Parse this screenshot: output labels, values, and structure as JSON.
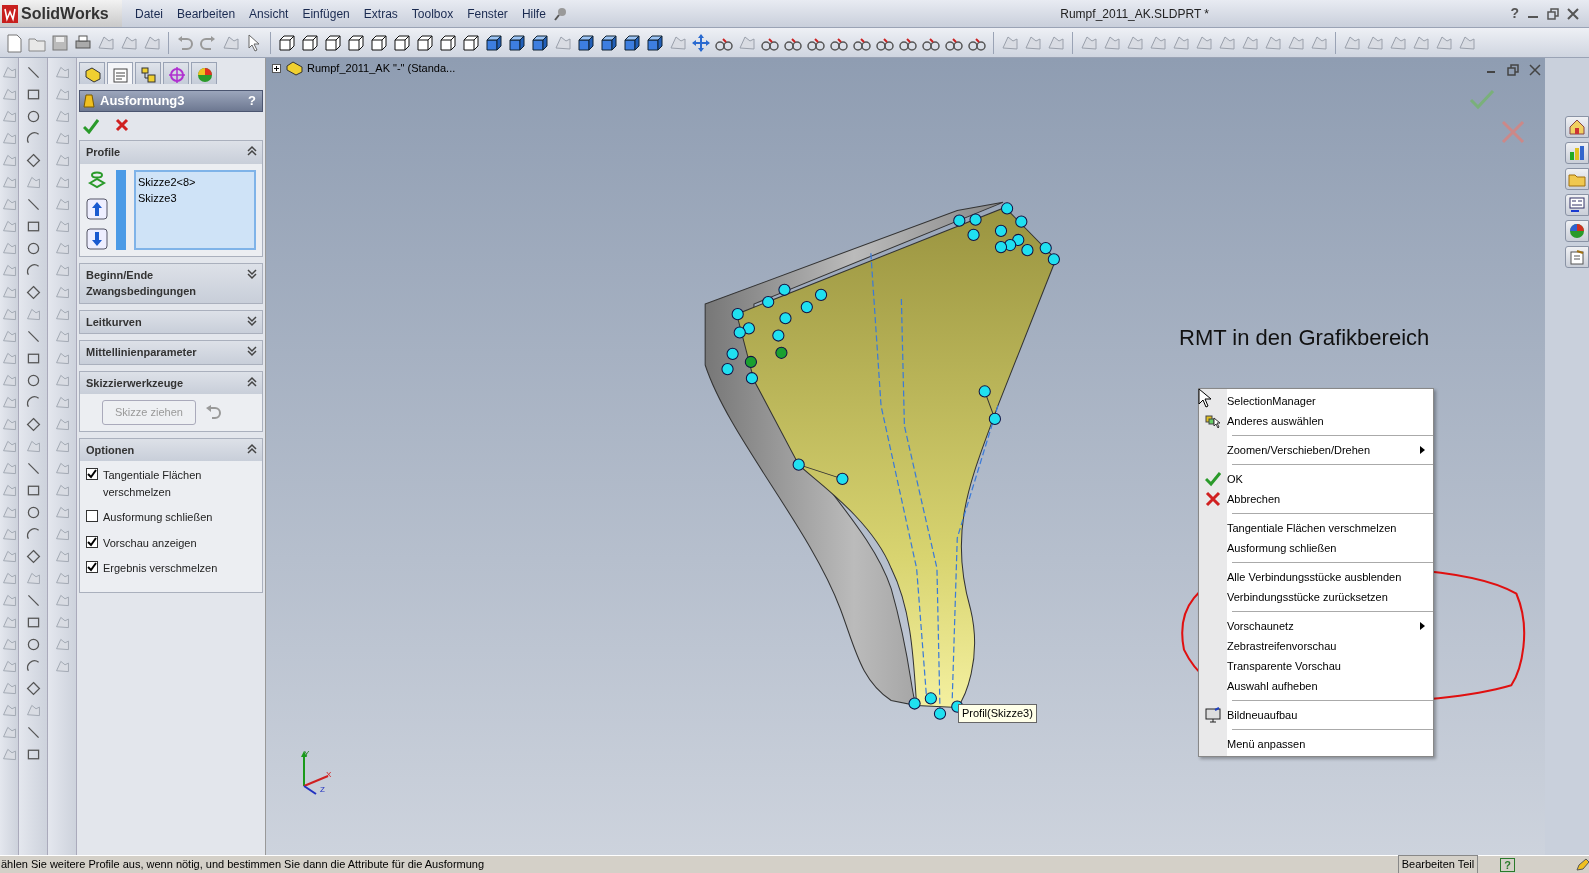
{
  "title_bar": {
    "logo": "SolidWorks",
    "menus": [
      "Datei",
      "Bearbeiten",
      "Ansicht",
      "Einfügen",
      "Extras",
      "Toolbox",
      "Fenster",
      "Hilfe"
    ],
    "title": "Rumpf_2011_AK.SLDPRT *",
    "help": "?"
  },
  "manager_tabs": [
    {
      "kind": "feature_tree",
      "selected": false
    },
    {
      "kind": "property",
      "selected": true
    },
    {
      "kind": "configuration",
      "selected": false
    },
    {
      "kind": "dimxpert",
      "selected": false
    },
    {
      "kind": "display",
      "selected": false
    }
  ],
  "feature": {
    "title": "Ausformung3",
    "help": "?"
  },
  "sections": [
    {
      "kind": "profiles",
      "title": "Profile",
      "expanded": true,
      "items": [
        "Skizze2<8>",
        "Skizze3"
      ]
    },
    {
      "title": "Beginn/Ende Zwangsbedingungen",
      "expanded": false
    },
    {
      "title": "Leitkurven",
      "expanded": false
    },
    {
      "title": "Mittellinienparameter",
      "expanded": false
    },
    {
      "kind": "sketch_tools",
      "title": "Skizzierwerkzeuge",
      "expanded": true,
      "button": {
        "label": "Skizze ziehen",
        "disabled": true
      }
    },
    {
      "kind": "options",
      "title": "Optionen",
      "expanded": true,
      "options": [
        {
          "label": "Tangentiale Flächen verschmelzen",
          "checked": true
        },
        {
          "label": "Ausformung schließen",
          "checked": false
        },
        {
          "label": "Vorschau anzeigen",
          "checked": true
        },
        {
          "label": "Ergebnis verschmelzen",
          "checked": true
        }
      ]
    }
  ],
  "graphics": {
    "tree_root": "Rumpf_2011_AK \"-\" (Standa...",
    "annotation": "RMT in den Grafikbereich",
    "tooltip": "Profil(Skizze3)",
    "triad": [
      "Y",
      "X",
      "Z"
    ]
  },
  "context_menu": {
    "groups": [
      [
        {
          "label": "SelectionManager",
          "kind": "plain",
          "submenu": false
        },
        {
          "label": "Anderes auswählen",
          "kind": "select_other",
          "submenu": false
        }
      ],
      [
        {
          "label": "Zoomen/Verschieben/Drehen",
          "kind": "plain",
          "submenu": true
        }
      ],
      [
        {
          "label": "OK",
          "kind": "ok",
          "submenu": false
        },
        {
          "label": "Abbrechen",
          "kind": "cancel",
          "submenu": false
        }
      ],
      [
        {
          "label": "Tangentiale Flächen verschmelzen",
          "kind": "plain",
          "submenu": false
        },
        {
          "label": "Ausformung schließen",
          "kind": "plain",
          "submenu": false
        }
      ],
      [
        {
          "label": "Alle Verbindungsstücke ausblenden",
          "kind": "plain",
          "submenu": false
        },
        {
          "label": "Verbindungsstücke zurücksetzen",
          "kind": "plain",
          "submenu": false
        }
      ],
      [
        {
          "label": "Vorschaunetz",
          "kind": "plain",
          "submenu": true
        },
        {
          "label": "Zebrastreifenvorschau",
          "kind": "plain",
          "submenu": false
        },
        {
          "label": "Transparente Vorschau",
          "kind": "plain",
          "submenu": false
        },
        {
          "label": "Auswahl aufheben",
          "kind": "plain",
          "submenu": false
        }
      ],
      [
        {
          "label": "Bildneuaufbau",
          "kind": "rebuild",
          "submenu": false
        }
      ],
      [
        {
          "label": "Menü anpassen",
          "kind": "plain",
          "submenu": false
        }
      ]
    ]
  },
  "status_bar": {
    "message": "ählen Sie weitere Profile aus, wenn nötig, und bestimmen Sie dann die Attribute für die Ausformung",
    "mode": "Bearbeiten Teil",
    "help": "?"
  }
}
